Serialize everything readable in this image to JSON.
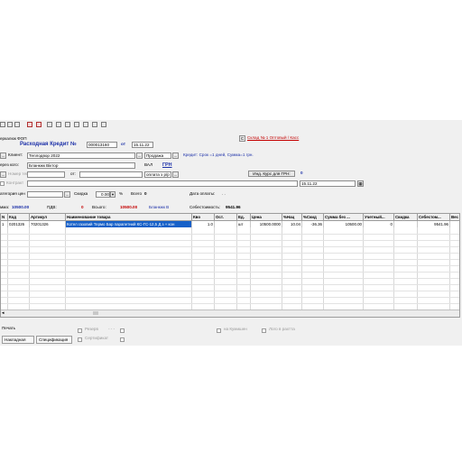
{
  "toolbar": {
    "icons": [
      "save-icon",
      "save-as-icon",
      "print-icon",
      "preview-icon",
      "copy-icon",
      "paste-icon",
      "delete-icon",
      "refresh-icon",
      "settings-icon",
      "help-icon",
      "calc-icon"
    ]
  },
  "header": {
    "warehouse_prefix": "С",
    "warehouse": "Склад № 1 Оптовый / Касс",
    "org": "еркалюк ФОП",
    "doc_title": "Расходная Кредит №",
    "doc_number": "000013160",
    "date_label": "от",
    "date": "15.11.22"
  },
  "client": {
    "label": "Клиент:",
    "value": "Теплодвор 2022",
    "sale_type": "Продажа",
    "credit_note": "Кредит: Срок =1 дней, Сумма=1 грн."
  },
  "via": {
    "label": "ерез кого:",
    "value": "Бланкжк Віктор",
    "val_label": "ВАЛ",
    "currency": "ГРН"
  },
  "from": {
    "label": "от:",
    "payment": "оплата з р/р",
    "rate_button": "Инд. Курс для ГРН:",
    "rate_value": "0"
  },
  "tax": {
    "label": "Номер тех",
    "contract_label": "Контракт",
    "date_value": "15.11.22"
  },
  "prices": {
    "category_label": "атегория цен",
    "discount_label": "Скидка",
    "discount_value": "0.00",
    "percent": "%",
    "total_label": "Всего",
    "total_value": "0",
    "pay_date_label": "Дата оплаты:",
    "pay_date_value": ". ."
  },
  "summary": {
    "sum_label": "мма:",
    "sum_value": "10500.00",
    "vat_label": "ПДВ:",
    "vat_value": "0",
    "all_label": "Всього:",
    "all_value": "10500.00",
    "person": "Бланкжк В",
    "cost_label": "Себестоимость:",
    "cost_value": "9541.96"
  },
  "table": {
    "columns": [
      "N",
      "Код",
      "Артикул",
      "Наименование товара",
      "Кво",
      "Ост.",
      "Ед.",
      "Цена",
      "%Нац",
      "%Скид",
      "Сумма без ...",
      "Учетный...",
      "Скидка",
      "Себестом...",
      "Вес"
    ],
    "rows": [
      [
        "1",
        "0201326",
        "70201326",
        "Котел газовий Термо Бар парапетний КС-ГС-12,5 Д з + кон",
        "1.0",
        "",
        "шт",
        "10500.0000",
        "10.04",
        "-36.36",
        "10500.00",
        "0",
        "",
        "9541.96",
        ""
      ]
    ]
  },
  "footer": {
    "print_label": "Печать",
    "tabs": [
      "Накладная",
      "Спецификация"
    ],
    "reserve_label": "Резерв",
    "cert_label": "Сертификат",
    "dash": "- - -",
    "to_cash_label": "на Кумишен",
    "after_label": "Лого в рахтта"
  }
}
